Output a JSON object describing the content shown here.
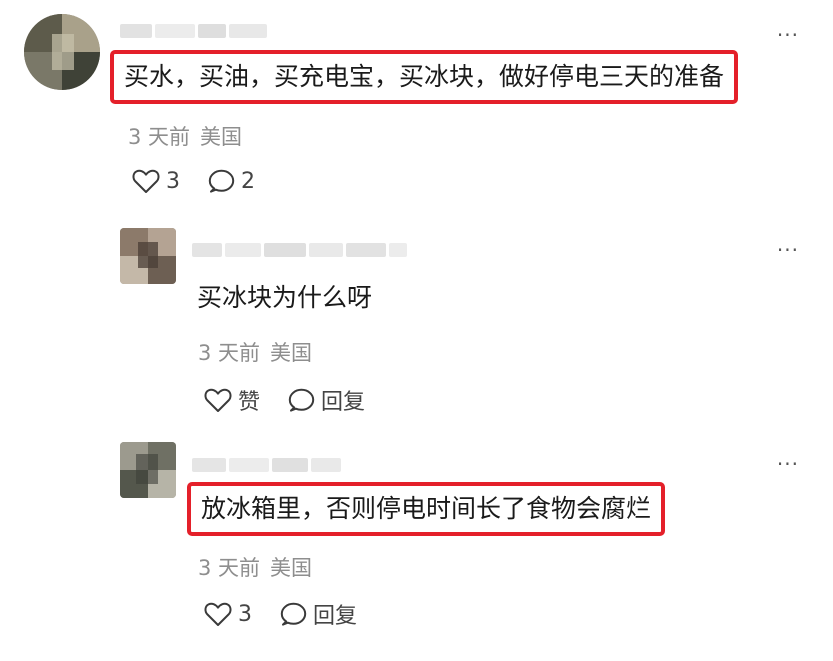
{
  "comments": [
    {
      "text": "买水，买油，买充电宝，买冰块，做好停电三天的准备",
      "time": "3 天前",
      "location": "美国",
      "like_label": "3",
      "reply_label": "2",
      "more_label": "···"
    },
    {
      "text": "买冰块为什么呀",
      "time": "3 天前",
      "location": "美国",
      "like_label": "赞",
      "reply_label": "回复",
      "more_label": "···"
    },
    {
      "text": "放冰箱里，否则停电时间长了食物会腐烂",
      "time": "3 天前",
      "location": "美国",
      "like_label": "3",
      "reply_label": "回复",
      "more_label": "···"
    }
  ],
  "highlight_color": "#e4202a",
  "icons": {
    "like": "heart-icon",
    "reply": "speech-bubble-icon",
    "more": "more-dots-icon"
  }
}
